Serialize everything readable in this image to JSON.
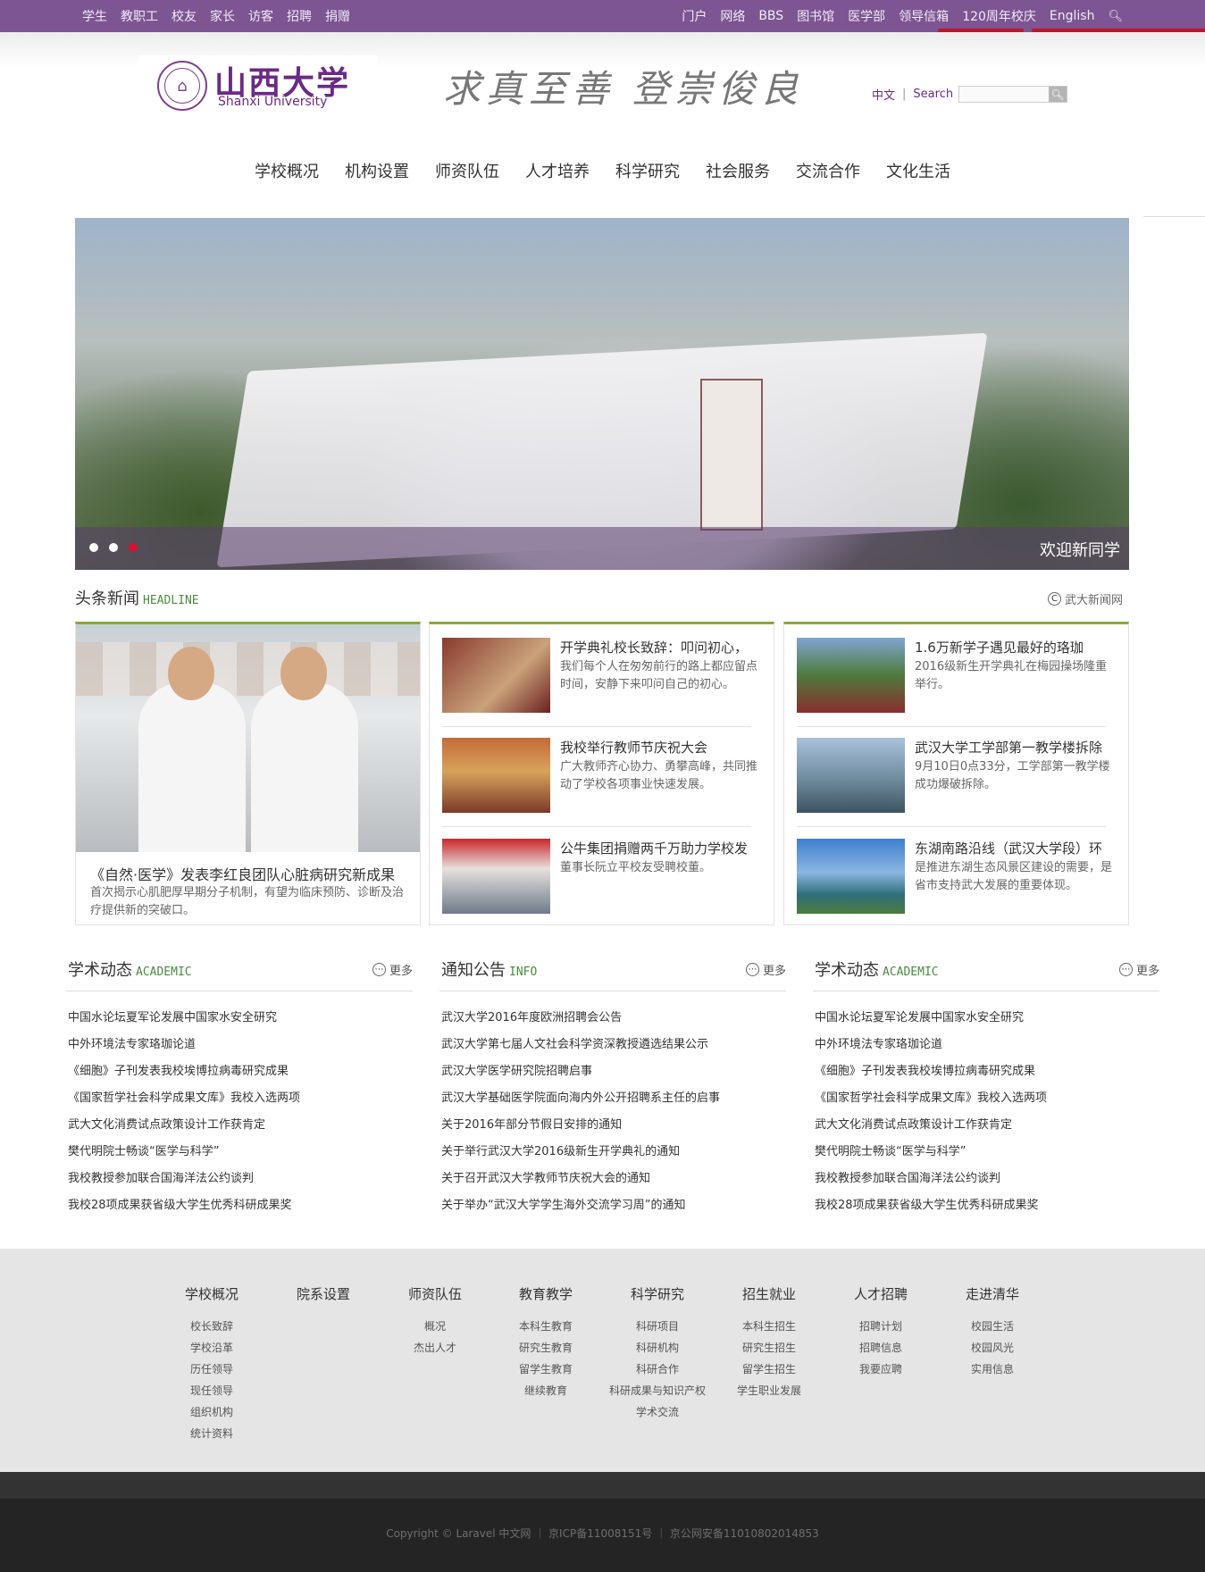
{
  "topbar": {
    "left_links": [
      "学生",
      "教职工",
      "校友",
      "家长",
      "访客",
      "招聘",
      "捐赠"
    ],
    "right_links": [
      "门户",
      "网络",
      "BBS",
      "图书馆",
      "医学部",
      "领导信箱",
      "120周年校庆",
      "English"
    ],
    "search_icon": "search-icon"
  },
  "header": {
    "logo_cn": "山西大学",
    "logo_en": "Shanxi University",
    "motto": "求真至善 登崇俊良",
    "lang": "中文",
    "lang_sep": "|",
    "search_label": "Search",
    "search_placeholder": ""
  },
  "mainnav": [
    "学校概况",
    "机构设置",
    "师资队伍",
    "人才培养",
    "科学研究",
    "社会服务",
    "交流合作",
    "文化生活"
  ],
  "banner": {
    "caption": "欢迎新同学",
    "dots": 3,
    "active_dot": 3
  },
  "headline": {
    "title": "头条新闻",
    "title_en": "HEADLINE",
    "more": "武大新闻网",
    "feature": {
      "title": "《自然·医学》发表李红良团队心脏病研究新成果",
      "desc": "首次揭示心肌肥厚早期分子机制，有望为临床预防、诊断及治疗提供新的突破口。"
    },
    "col2": [
      {
        "title": "开学典礼校长致辞：叩问初心，",
        "desc": "我们每个人在匆匆前行的路上都应留点时间，安静下来叩问自己的初心。"
      },
      {
        "title": "我校举行教师节庆祝大会",
        "desc": "广大教师齐心协力、勇攀高峰，共同推动了学校各项事业快速发展。"
      },
      {
        "title": "公牛集团捐赠两千万助力学校发",
        "desc": "董事长阮立平校友受聘校董。"
      }
    ],
    "col3": [
      {
        "title": "1.6万新学子遇见最好的珞珈",
        "desc": "2016级新生开学典礼在梅园操场隆重举行。"
      },
      {
        "title": "武汉大学工学部第一教学楼拆除",
        "desc": "9月10日0点33分，工学部第一教学楼成功爆破拆除。"
      },
      {
        "title": "东湖南路沿线（武汉大学段）环",
        "desc": "是推进东湖生态风景区建设的需要，是省市支持武大发展的重要体现。"
      }
    ]
  },
  "columns": [
    {
      "title": "学术动态",
      "title_en": "ACADEMIC",
      "more": "更多",
      "items": [
        "中国水论坛夏军论发展中国家水安全研究",
        "中外环境法专家珞珈论道",
        "《细胞》子刊发表我校埃博拉病毒研究成果",
        "《国家哲学社会科学成果文库》我校入选两项",
        "武大文化消费试点政策设计工作获肯定",
        "樊代明院士畅谈“医学与科学”",
        "我校教授参加联合国海洋法公约谈判",
        "我校28项成果获省级大学生优秀科研成果奖"
      ]
    },
    {
      "title": "通知公告",
      "title_en": "INFO",
      "more": "更多",
      "items": [
        "武汉大学2016年度欧洲招聘会公告",
        "武汉大学第七届人文社会科学资深教授遴选结果公示",
        "武汉大学医学研究院招聘启事",
        "武汉大学基础医学院面向海内外公开招聘系主任的启事",
        "关于2016年部分节假日安排的通知",
        "关于举行武汉大学2016级新生开学典礼的通知",
        "关于召开武汉大学教师节庆祝大会的通知",
        "关于举办“武汉大学学生海外交流学习周”的通知"
      ]
    },
    {
      "title": "学术动态",
      "title_en": "ACADEMIC",
      "more": "更多",
      "items": [
        "中国水论坛夏军论发展中国家水安全研究",
        "中外环境法专家珞珈论道",
        "《细胞》子刊发表我校埃博拉病毒研究成果",
        "《国家哲学社会科学成果文库》我校入选两项",
        "武大文化消费试点政策设计工作获肯定",
        "樊代明院士畅谈“医学与科学”",
        "我校教授参加联合国海洋法公约谈判",
        "我校28项成果获省级大学生优秀科研成果奖"
      ]
    }
  ],
  "footer_nav": [
    {
      "title": "学校概况",
      "items": [
        "校长致辞",
        "学校沿革",
        "历任领导",
        "现任领导",
        "组织机构",
        "统计资料"
      ]
    },
    {
      "title": "院系设置",
      "items": []
    },
    {
      "title": "师资队伍",
      "items": [
        "概况",
        "杰出人才"
      ]
    },
    {
      "title": "教育教学",
      "items": [
        "本科生教育",
        "研究生教育",
        "留学生教育",
        "继续教育"
      ]
    },
    {
      "title": "科学研究",
      "items": [
        "科研项目",
        "科研机构",
        "科研合作",
        "科研成果与知识产权",
        "学术交流"
      ]
    },
    {
      "title": "招生就业",
      "items": [
        "本科生招生",
        "研究生招生",
        "留学生招生",
        "学生职业发展"
      ]
    },
    {
      "title": "人才招聘",
      "items": [
        "招聘计划",
        "招聘信息",
        "我要应聘"
      ]
    },
    {
      "title": "走进清华",
      "items": [
        "校园生活",
        "校园风光",
        "实用信息"
      ]
    }
  ],
  "copyright": "Copyright © Laravel 中文网  ｜  京ICP备11008151号  ｜  京公网安备11010802014853",
  "colors": {
    "brand": "#7c5592",
    "accent_red": "#c0152a",
    "green": "#8aa83a"
  }
}
